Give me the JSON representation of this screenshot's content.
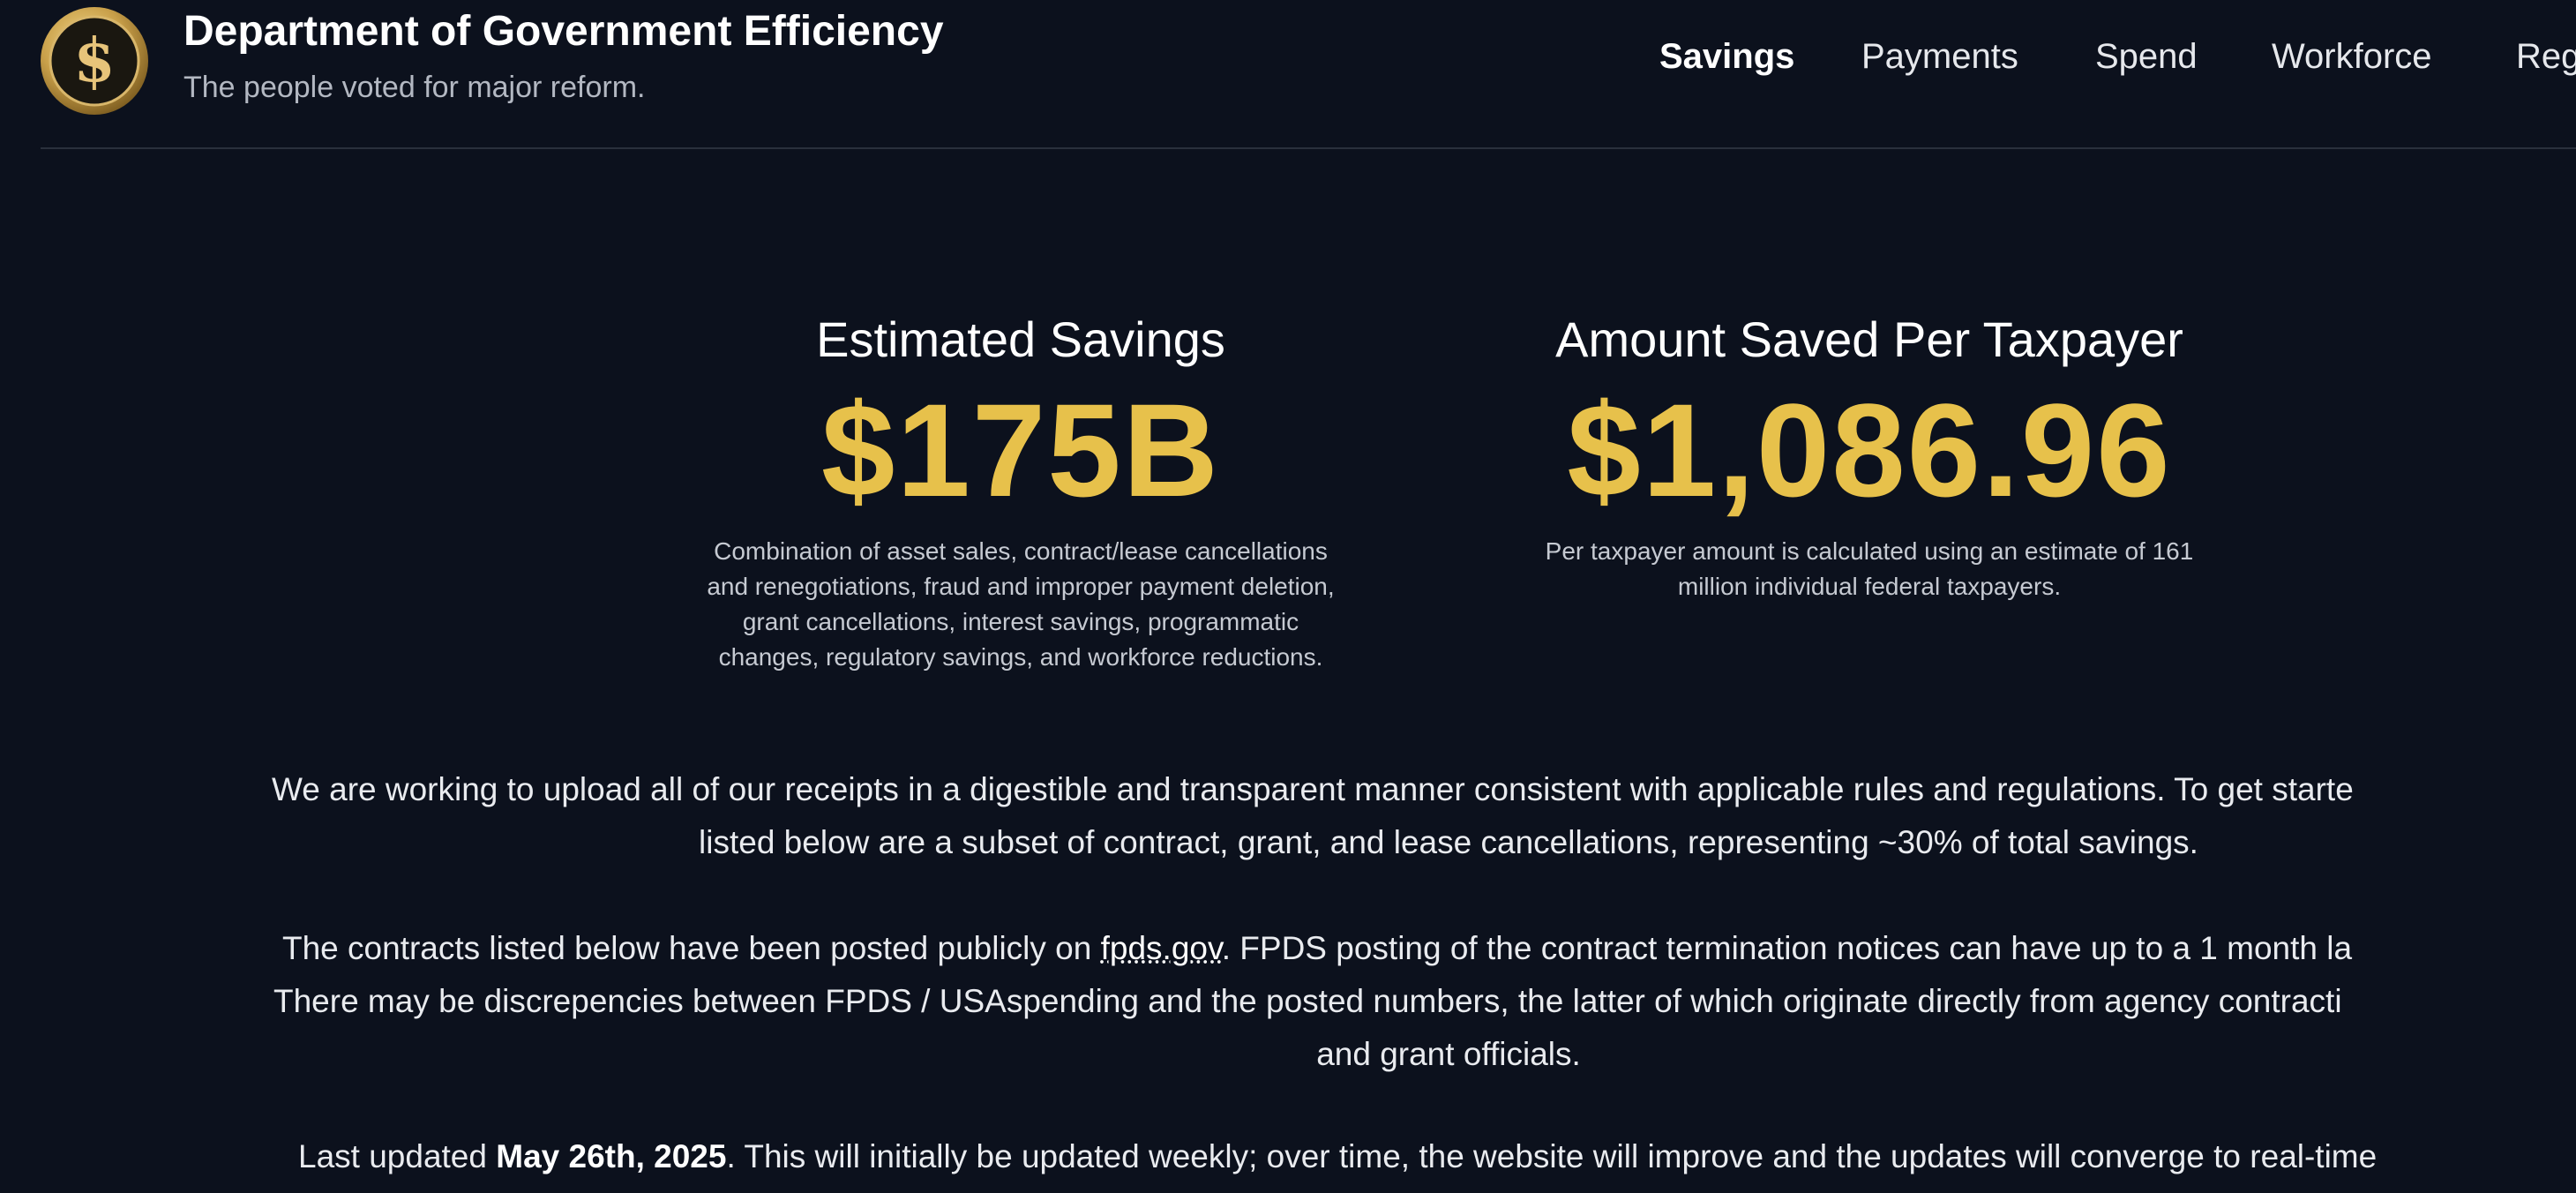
{
  "header": {
    "title": "Department of Government Efficiency",
    "subtitle": "The people voted for major reform.",
    "logo_icon": "dollar-coin-icon"
  },
  "nav": {
    "items": [
      {
        "label": "Savings",
        "active": true
      },
      {
        "label": "Payments",
        "active": false
      },
      {
        "label": "Spend",
        "active": false
      },
      {
        "label": "Workforce",
        "active": false
      },
      {
        "label": "Reg",
        "active": false
      }
    ]
  },
  "stats": {
    "savings": {
      "label": "Estimated Savings",
      "value": "$175B",
      "description_lines": [
        "Combination of asset sales, contract/lease cancellations",
        "and renegotiations, fraud and improper payment deletion,",
        "grant cancellations, interest savings, programmatic",
        "changes, regulatory savings, and workforce reductions."
      ]
    },
    "per_taxpayer": {
      "label": "Amount Saved Per Taxpayer",
      "value": "$1,086.96",
      "description_lines": [
        "Per taxpayer amount is calculated using an estimate of 161",
        "million individual federal taxpayers."
      ]
    }
  },
  "body": {
    "para1": {
      "line1": "We are working to upload all of our receipts in a digestible and transparent manner consistent with applicable rules and regulations. To get starte",
      "line2": "listed below are a subset of contract, grant, and lease cancellations, representing ~30% of total savings."
    },
    "para2": {
      "line1_before": "The contracts listed below have been posted publicly on ",
      "link": "fpds.gov",
      "line1_after": ". FPDS posting of the contract termination notices can have up to a 1 month la",
      "line2": "There may be discrepencies between FPDS / USAspending and the posted numbers, the latter of which originate directly from agency contracti",
      "line3": "and grant officials."
    },
    "para3": {
      "before": "Last updated ",
      "date": "May 26th, 2025",
      "after": ". This will initially be updated weekly; over time, the website will improve and the updates will converge to real-time"
    }
  },
  "colors": {
    "background": "#0c111d",
    "accent_gold": "#e7c14b",
    "divider": "#2a303c"
  }
}
